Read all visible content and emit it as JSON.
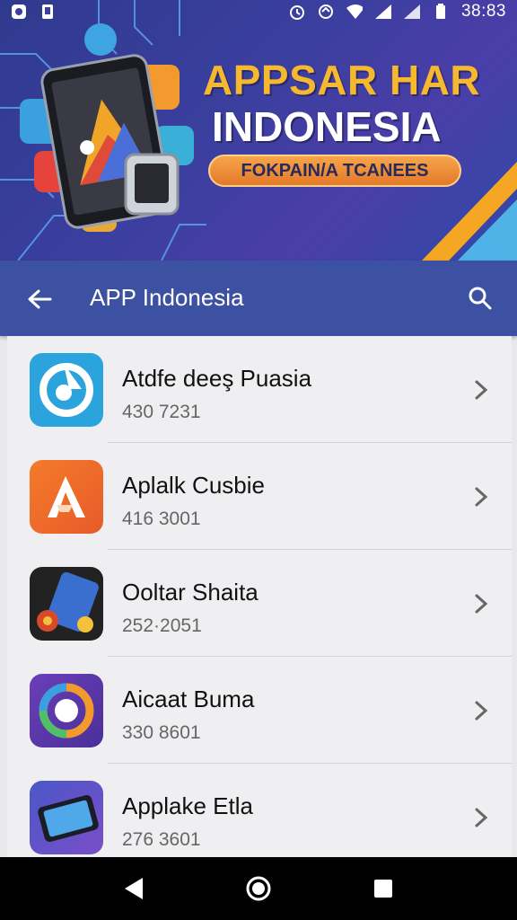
{
  "status_bar": {
    "time": "38:83",
    "icons": [
      "notification-icon",
      "sim-icon",
      "alarm-icon",
      "wifi-icon",
      "signal-icon",
      "battery-icon"
    ]
  },
  "banner": {
    "title": "APPSAR HAR",
    "subtitle": "INDONESIA",
    "pill": "FOKPAIN/A TCANEES",
    "colors": {
      "title": "#f5b82e",
      "pill": "#e2792a",
      "background": "#3b3f9f"
    }
  },
  "app_bar": {
    "title": "APP Indonesia",
    "back_icon": "arrow-left-icon",
    "search_icon": "search-icon",
    "color": "#3d51a2"
  },
  "apps": [
    {
      "name": "Atdfe deeş Puasia",
      "meta": "430 7231"
    },
    {
      "name": "Aplalk Cusbie",
      "meta": "416 3001"
    },
    {
      "name": "Ooltar Shaita",
      "meta": "252·2051"
    },
    {
      "name": "Aicaat Buma",
      "meta": "330 8601"
    },
    {
      "name": "Applake Etla",
      "meta": "276 3601"
    }
  ],
  "nav_bar": {
    "buttons": [
      "back-triangle-icon",
      "home-circle-icon",
      "recents-square-icon"
    ]
  }
}
